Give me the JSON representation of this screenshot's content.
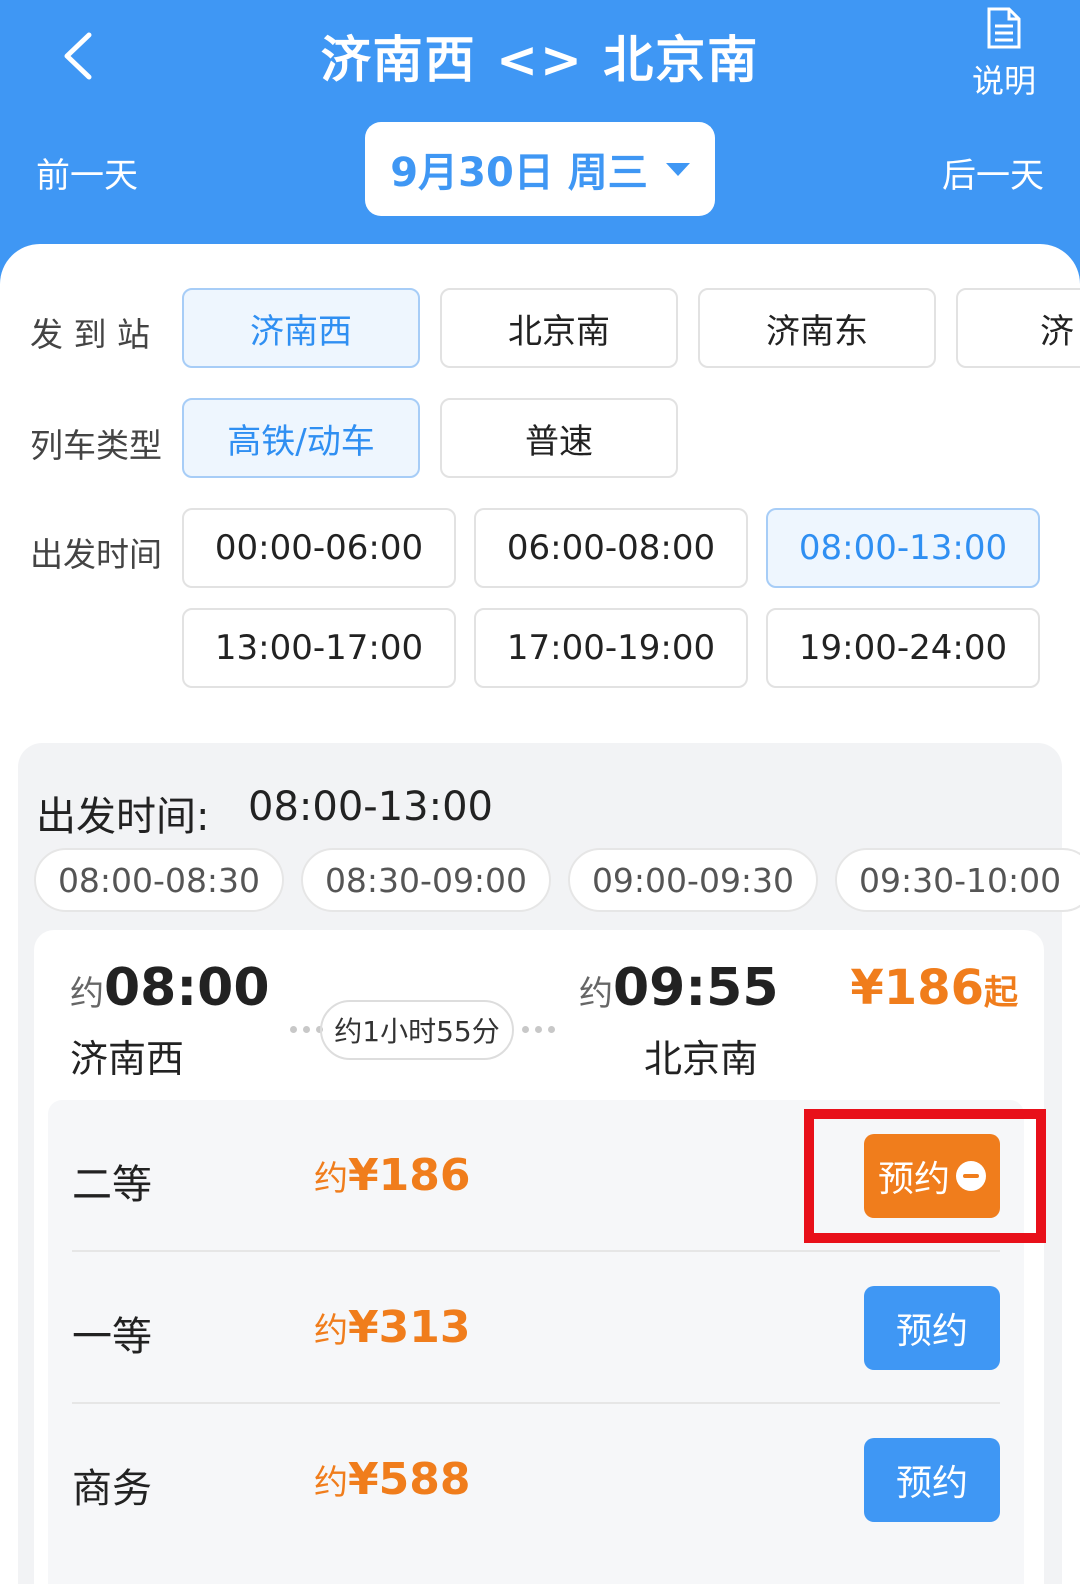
{
  "header": {
    "title": "济南西 <> 北京南",
    "help_label": "说明",
    "prev_day": "前一天",
    "next_day": "后一天",
    "date": "9月30日 周三"
  },
  "filters": {
    "station_label": "发 到 站",
    "stations": [
      "济南西",
      "北京南",
      "济南东",
      "济"
    ],
    "train_type_label": "列车类型",
    "train_types": [
      "高铁/动车",
      "普速"
    ],
    "time_label": "出发时间",
    "time_ranges": [
      "00:00-06:00",
      "06:00-08:00",
      "08:00-13:00",
      "13:00-17:00",
      "17:00-19:00",
      "19:00-24:00"
    ]
  },
  "departure": {
    "label": "出发时间:",
    "range": "08:00-13:00",
    "slots": [
      "08:00-08:30",
      "08:30-09:00",
      "09:00-09:30",
      "09:30-10:00"
    ]
  },
  "train": {
    "approx": "约",
    "dep_time": "08:00",
    "dep_station": "济南西",
    "arr_time": "09:55",
    "arr_station": "北京南",
    "duration": "约1小时55分",
    "price_from": "¥186",
    "price_suffix": "起",
    "seats": [
      {
        "name": "二等",
        "approx": "约",
        "price": "¥186",
        "button": "预约"
      },
      {
        "name": "一等",
        "approx": "约",
        "price": "¥313",
        "button": "预约"
      },
      {
        "name": "商务",
        "approx": "约",
        "price": "¥588",
        "button": "预约"
      }
    ]
  },
  "colors": {
    "primary": "#3f97f4",
    "accent_orange": "#f07d1c",
    "highlight_red": "#e8101a"
  }
}
